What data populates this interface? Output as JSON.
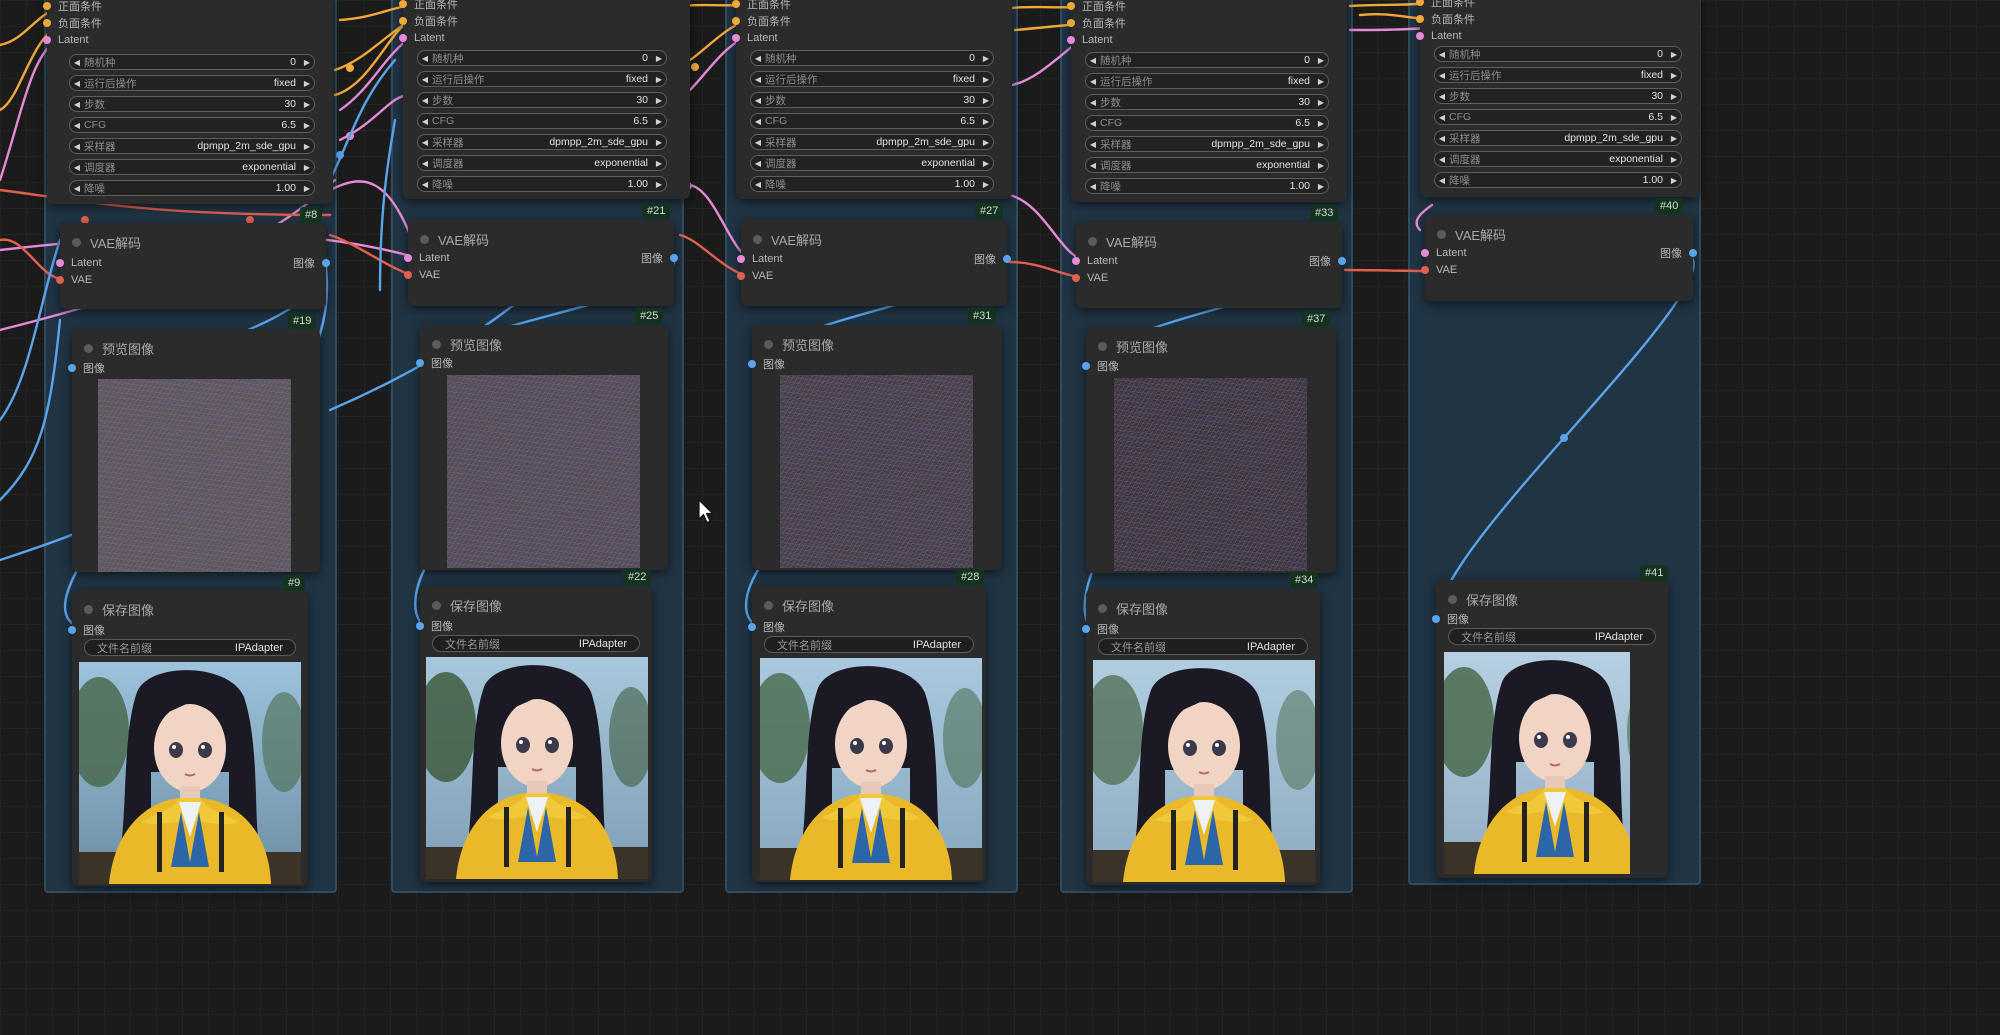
{
  "colors": {
    "canvas": "#1b1b1b",
    "group_fill": "#203444",
    "node_fill": "#2b2b2b",
    "badge_fill": "#14331e",
    "wire_latent": "#e48ad6",
    "wire_vae": "#e0604e",
    "wire_image": "#5aa4ec",
    "wire_conditioning": "#f0a838"
  },
  "labels": {
    "positive": "正面条件",
    "negative": "负面条件",
    "latent": "Latent",
    "vae": "VAE",
    "image": "图像",
    "vae_decode_title": "VAE解码",
    "preview_title": "预览图像",
    "save_title": "保存图像",
    "filename_prefix_name": "文件名前缀",
    "filename_prefix_value": "IPAdapter"
  },
  "sampler_widgets": {
    "seed": {
      "name": "随机种",
      "value": "0"
    },
    "control_after": {
      "name": "运行后操作",
      "value": "fixed"
    },
    "steps": {
      "name": "步数",
      "value": "30"
    },
    "cfg": {
      "name": "CFG",
      "value": "6.5"
    },
    "sampler": {
      "name": "采样器",
      "value": "dpmpp_2m_sde_gpu"
    },
    "scheduler": {
      "name": "调度器",
      "value": "exponential"
    },
    "denoise": {
      "name": "降噪",
      "value": "1.00"
    }
  },
  "columns": [
    {
      "sampler_id": "#8",
      "decode_id": "#19",
      "preview_id": "#9",
      "save_id": "#22"
    },
    {
      "sampler_id": "#21",
      "decode_id": "#25",
      "preview_id": "#22",
      "save_id": "#28"
    },
    {
      "sampler_id": "#27",
      "decode_id": "#31",
      "preview_id": "#28",
      "save_id": "#34"
    },
    {
      "sampler_id": "#33",
      "decode_id": "#37",
      "preview_id": "#34",
      "save_id": ""
    },
    {
      "sampler_id": "#40",
      "decode_id": "",
      "preview_id": "#41",
      "save_id": ""
    }
  ],
  "icons": [
    "title-dot-icon",
    "arrow-left-icon",
    "arrow-right-icon",
    "mouse-cursor-icon",
    "noise-preview-image",
    "anime-portrait-image"
  ]
}
